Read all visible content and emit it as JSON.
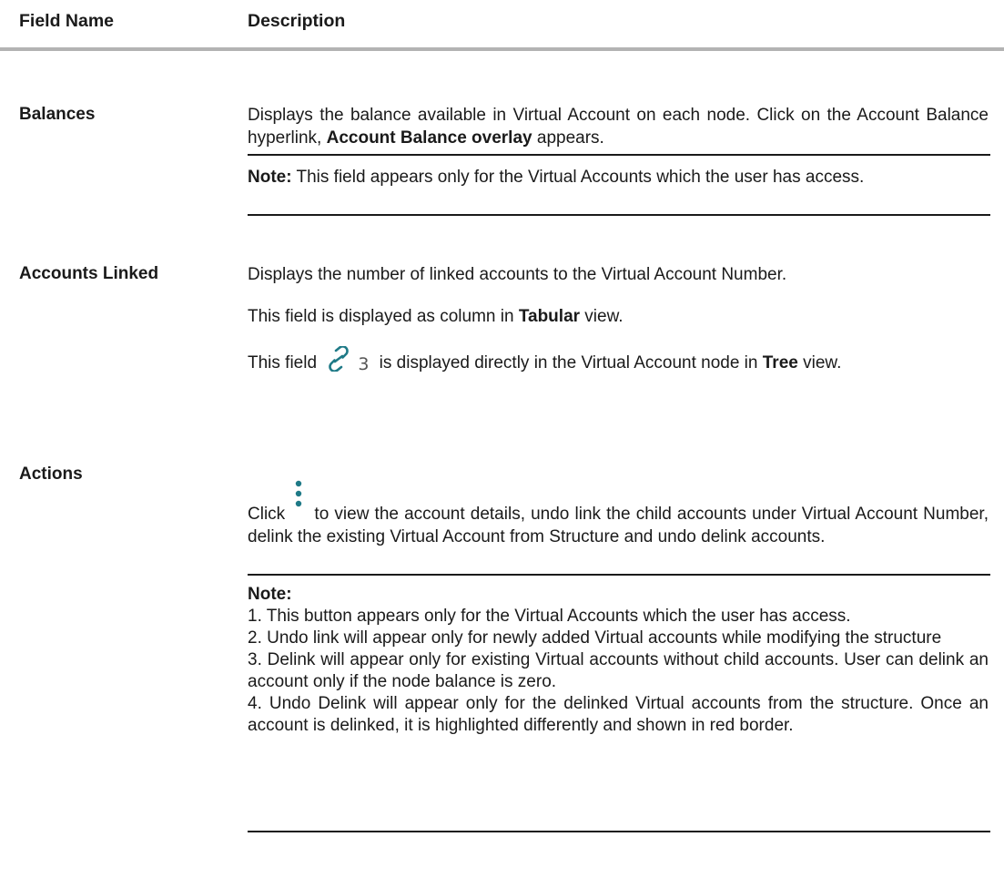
{
  "header": {
    "field_name": "Field Name",
    "description": "Description"
  },
  "rows": {
    "balances": {
      "name": "Balances",
      "desc_prefix": "Displays the balance available in Virtual Account on each node. Click on the Account Balance hyperlink, ",
      "desc_bold": "Account Balance overlay",
      "desc_suffix": " appears.",
      "note_label": "Note:",
      "note_text": " This field appears only for the Virtual Accounts which the user has access."
    },
    "accounts_linked": {
      "name": "Accounts Linked",
      "p1": "Displays the number of linked accounts to the Virtual Account Number.",
      "p2_prefix": "This field is displayed as column in ",
      "p2_bold": "Tabular",
      "p2_suffix": " view.",
      "p3_prefix": "This field ",
      "p3_icon_count": "3",
      "p3_mid": " is displayed directly in the Virtual Account node in ",
      "p3_bold": "Tree",
      "p3_suffix": " view."
    },
    "actions": {
      "name": "Actions",
      "p1_prefix": "Click ",
      "p1_suffix": " to view the account details, undo link the child accounts under Virtual Account Number, delink the existing Virtual Account from Structure and undo delink accounts.",
      "note_label": "Note:",
      "notes": [
        "1. This button appears only for the Virtual Accounts which the user has access.",
        "2. Undo link will appear only for newly added Virtual accounts while modifying the structure",
        "3. Delink will appear only for existing Virtual accounts without child accounts. User can delink an account only if the node balance is zero.",
        "4. Undo Delink will appear only for the delinked Virtual accounts from the structure. Once an account is delinked, it is highlighted differently and shown in red border."
      ]
    }
  },
  "colors": {
    "icon_teal": "#1f7a87",
    "rule_gray": "#b3b3b3",
    "text": "#1a1a1a"
  },
  "icons": {
    "link": "link-icon",
    "kebab": "kebab-menu-icon"
  }
}
